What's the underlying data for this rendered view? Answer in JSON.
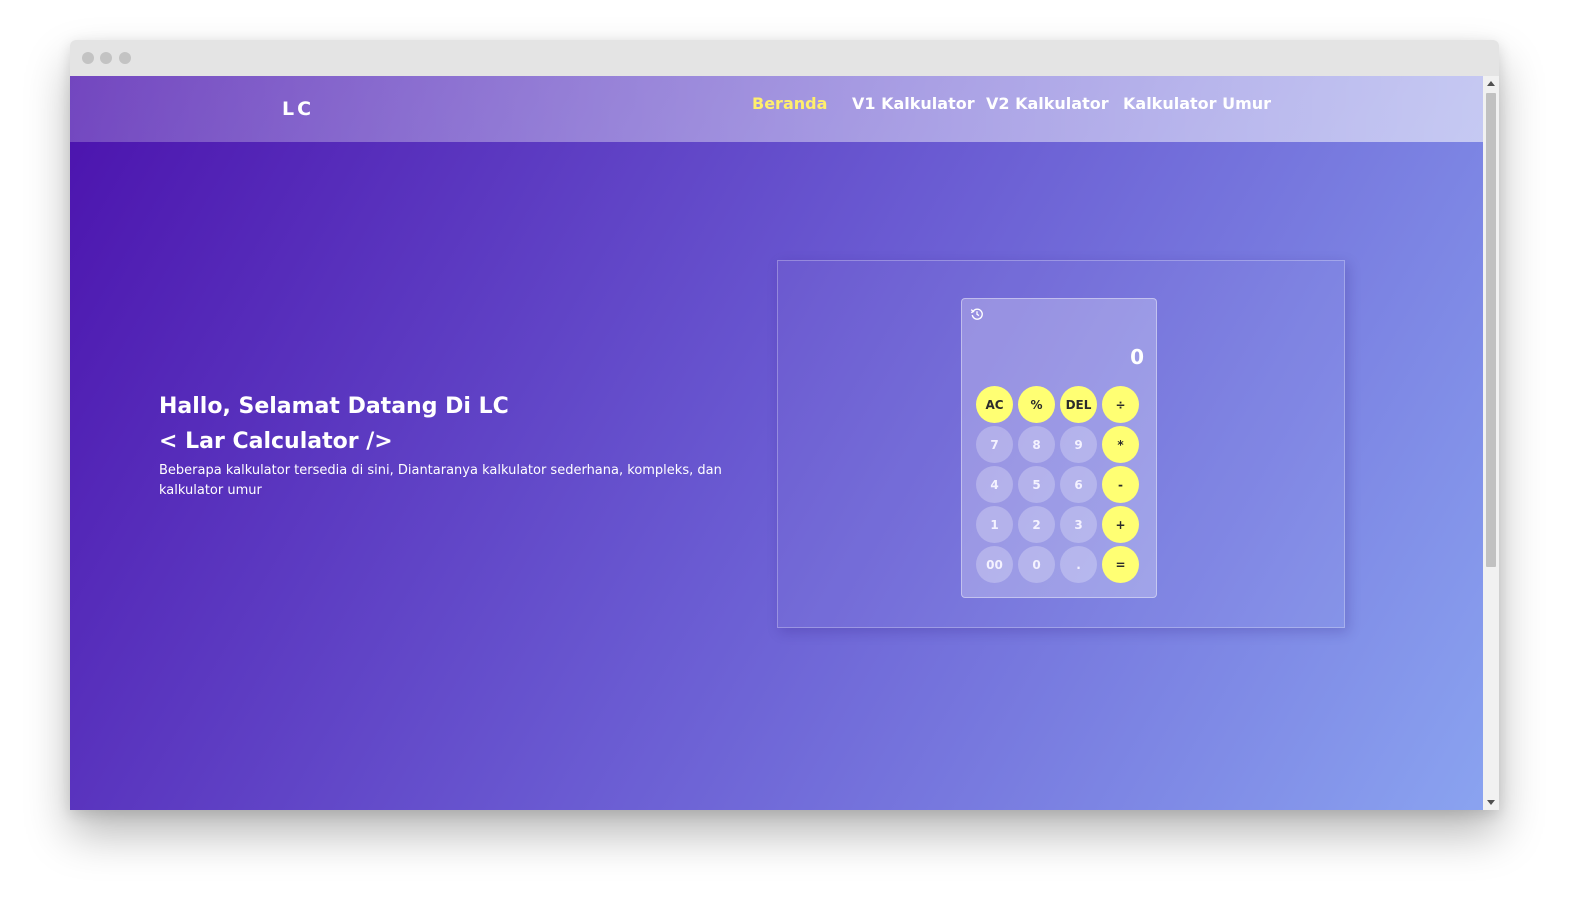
{
  "navbar": {
    "brand": "LC",
    "links": [
      {
        "label": "Beranda",
        "active": true
      },
      {
        "label": "V1 Kalkulator",
        "active": false
      },
      {
        "label": "V2 Kalkulator",
        "active": false
      },
      {
        "label": "Kalkulator Umur",
        "active": false
      }
    ]
  },
  "hero": {
    "greeting": "Hallo, Selamat Datang Di LC",
    "title": "< Lar Calculator />",
    "description": "Beberapa kalkulator tersedia di sini, Diantaranya kalkulator sederhana, kompleks, dan kalkulator umur"
  },
  "calculator": {
    "history_icon": "history-icon",
    "display": "0",
    "keys": [
      {
        "label": "AC",
        "type": "op"
      },
      {
        "label": "%",
        "type": "op"
      },
      {
        "label": "DEL",
        "type": "op"
      },
      {
        "label": "÷",
        "type": "op"
      },
      {
        "label": "7",
        "type": "num"
      },
      {
        "label": "8",
        "type": "num"
      },
      {
        "label": "9",
        "type": "num"
      },
      {
        "label": "*",
        "type": "op"
      },
      {
        "label": "4",
        "type": "num"
      },
      {
        "label": "5",
        "type": "num"
      },
      {
        "label": "6",
        "type": "num"
      },
      {
        "label": "-",
        "type": "op"
      },
      {
        "label": "1",
        "type": "num"
      },
      {
        "label": "2",
        "type": "num"
      },
      {
        "label": "3",
        "type": "num"
      },
      {
        "label": "+",
        "type": "op"
      },
      {
        "label": "00",
        "type": "num"
      },
      {
        "label": "0",
        "type": "num"
      },
      {
        "label": ".",
        "type": "num"
      },
      {
        "label": "=",
        "type": "op"
      }
    ]
  },
  "colors": {
    "accent": "#ffef6b",
    "operator_key": "#ffff73",
    "gradient_start": "#4b12ad",
    "gradient_end": "#8aa3f0"
  }
}
